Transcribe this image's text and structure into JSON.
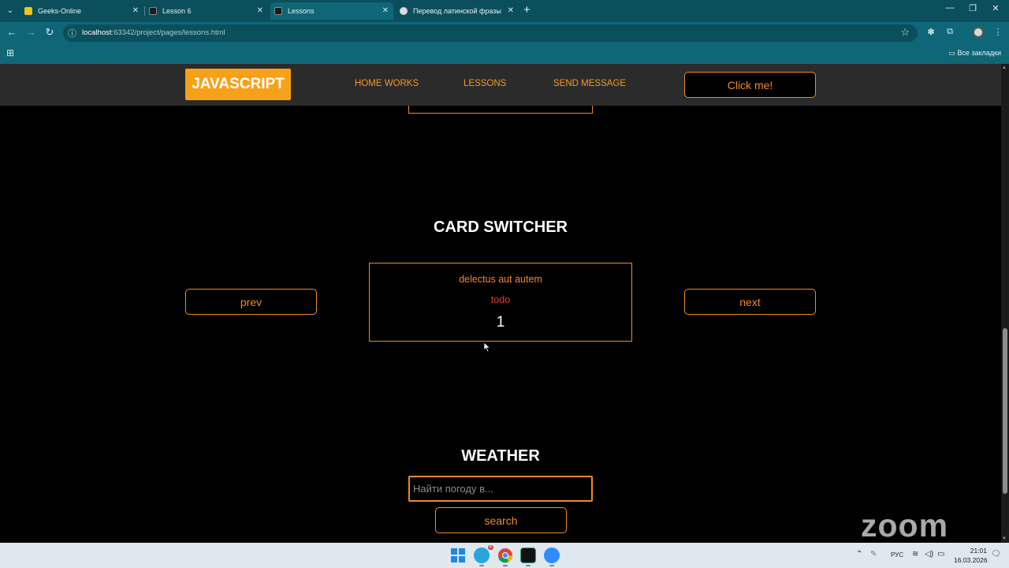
{
  "browser": {
    "tabs": [
      {
        "title": "Geeks-Online",
        "active": false,
        "favicon_color": "#f2c318"
      },
      {
        "title": "Lesson 6",
        "active": false,
        "favicon_color": "#1c1c1c"
      },
      {
        "title": "Lessons",
        "active": true,
        "favicon_color": "#1c1c1c"
      },
      {
        "title": "Перевод латинской фразы",
        "active": false,
        "favicon_color": "#d9d9d9"
      }
    ],
    "url_host": "localhost",
    "url_path": ":63342/project/pages/lessons.html",
    "bookmarks_all": "Все закладки"
  },
  "site": {
    "logo": "JAVASCRIPT",
    "nav": [
      "HOME WORKS",
      "LESSONS",
      "SEND MESSAGE"
    ],
    "click_me": "Click me!"
  },
  "card_switcher": {
    "title": "CARD SWITCHER",
    "prev_label": "prev",
    "next_label": "next",
    "card": {
      "title": "delectus aut autem",
      "status": "todo",
      "id": "1"
    }
  },
  "weather": {
    "title": "WEATHER",
    "input_placeholder": "Найти погоду в...",
    "search_label": "search"
  },
  "watermark": "zoom",
  "taskbar": {
    "telegram_badge": "4",
    "language": "РУС",
    "time": "21:01",
    "date": "16.03.2026"
  },
  "colors": {
    "accent": "#f08a24",
    "logo_bg": "#f7a11a",
    "status_red": "#e53b2c",
    "header_bg": "#2b2b2b"
  }
}
